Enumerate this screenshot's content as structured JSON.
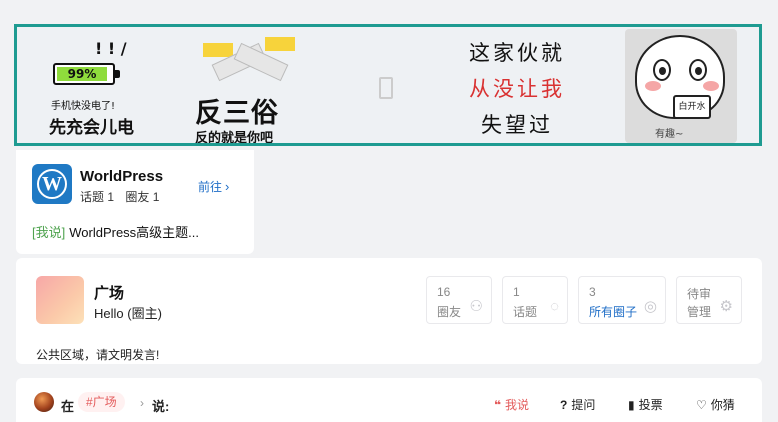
{
  "banner": {
    "battery_percent": "99%",
    "battery_low_text": "手机快没电了!",
    "battery_big_text": "先充会儿电",
    "anti_title": "反三俗",
    "anti_subtitle": "反的就是你吧",
    "poem_lines": [
      "这家伙就",
      "从没让我",
      "失望过"
    ],
    "face_cup_text": "白开水",
    "face_note": "有趣~"
  },
  "circle": {
    "name": "WorldPress",
    "topics": "话题 1",
    "friends": "圈友 1",
    "goto_label": "前往",
    "said_tag": "[我说]",
    "said_text": "WorldPress高级主题..."
  },
  "square": {
    "title": "广场",
    "owner": "Hello (圈主)",
    "description": "公共区域，请文明发言!",
    "stats": [
      {
        "value": "16",
        "label": "圈友",
        "icon": "users-icon"
      },
      {
        "value": "1",
        "label": "话题",
        "icon": "chat-icon"
      },
      {
        "value": "3",
        "label": "所有圈子",
        "icon": "circles-icon"
      },
      {
        "value": "待审",
        "label": "管理",
        "icon": "gear-icon"
      }
    ]
  },
  "post_bar": {
    "in_text": "在",
    "topic": "#广场",
    "say_text": "说:",
    "actions": {
      "say": "我说",
      "ask": "提问",
      "vote": "投票",
      "guess": "你猜"
    }
  },
  "colors": {
    "accent_blue": "#1f6ec7",
    "accent_red": "#e35b5b",
    "banner_border": "#1e9b91",
    "wordpress_blue": "#1f79c4"
  }
}
